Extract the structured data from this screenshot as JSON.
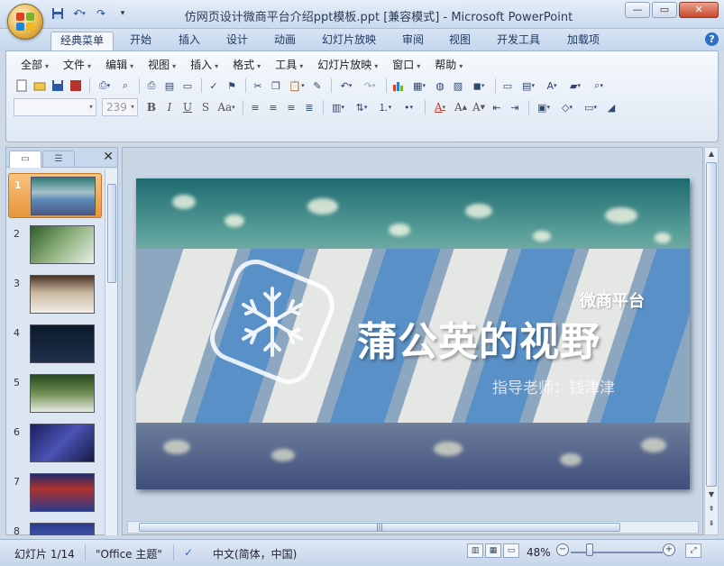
{
  "window": {
    "title": "仿网页设计微商平台介绍ppt模板.ppt [兼容模式] - Microsoft PowerPoint",
    "minimize": "—",
    "maximize": "▭",
    "close": "✕"
  },
  "ribbon_tabs": [
    {
      "label": "经典菜单",
      "active": true
    },
    {
      "label": "开始"
    },
    {
      "label": "插入"
    },
    {
      "label": "设计"
    },
    {
      "label": "动画"
    },
    {
      "label": "幻灯片放映"
    },
    {
      "label": "审阅"
    },
    {
      "label": "视图"
    },
    {
      "label": "开发工具"
    },
    {
      "label": "加载项"
    }
  ],
  "menus": [
    "全部",
    "文件",
    "编辑",
    "视图",
    "插入",
    "格式",
    "工具",
    "幻灯片放映",
    "窗口",
    "帮助"
  ],
  "toolbar": {
    "font_name": "",
    "font_size": "239"
  },
  "side_panel": {
    "tabs": [
      "slides-tab",
      "outline-tab"
    ],
    "close": "✕",
    "thumbnails": [
      "1",
      "2",
      "3",
      "4",
      "5",
      "6",
      "7",
      "8"
    ]
  },
  "slide": {
    "subtitle": "微商平台",
    "title": "蒲公英的视野",
    "author": "指导老师：钱津津"
  },
  "statusbar": {
    "slide_indicator": "幻灯片 1/14",
    "theme": "\"Office 主题\"",
    "language": "中文(简体，中国)",
    "zoom": "48%",
    "zoom_fraction": 0.48
  },
  "icons": [
    "office-button-icon",
    "save-icon",
    "undo-icon",
    "redo-icon",
    "help-icon",
    "new-icon",
    "open-icon",
    "print-icon",
    "cut-icon",
    "copy-icon",
    "paste-icon",
    "chart-icon",
    "table-icon",
    "bold-icon",
    "italic-icon",
    "underline-icon"
  ],
  "colors": {
    "accent_tab": "#f3f7fc",
    "selected_thumb": "#e79638",
    "ribbon_bg": "#dfe8f4"
  }
}
